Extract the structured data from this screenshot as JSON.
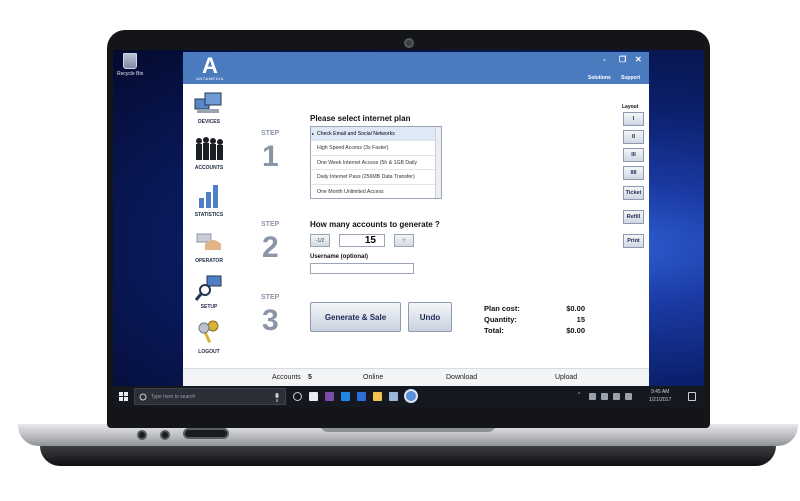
{
  "desktop": {
    "recycle_label": "Recycle Bin"
  },
  "app": {
    "logo_letter": "A",
    "logo_text": "ANTAMEDIA",
    "window_controls": {
      "minimize": "-",
      "restore": "❐",
      "close": "✕"
    },
    "top_links": [
      "Solutions",
      "Support"
    ],
    "nav": [
      {
        "label": "DEVICES",
        "icon": "devices-icon"
      },
      {
        "label": "ACCOUNTS",
        "icon": "accounts-icon"
      },
      {
        "label": "STATISTICS",
        "icon": "statistics-icon"
      },
      {
        "label": "OPERATOR",
        "icon": "operator-icon"
      },
      {
        "label": "SETUP",
        "icon": "setup-icon"
      },
      {
        "label": "LOGOUT",
        "icon": "logout-icon"
      }
    ],
    "steps": [
      {
        "label": "STEP",
        "number": "1"
      },
      {
        "label": "STEP",
        "number": "2"
      },
      {
        "label": "STEP",
        "number": "3"
      }
    ],
    "step1": {
      "heading": "Please select internet plan",
      "plans": [
        "Check Email and Social Networks",
        "High Speed Access (3x Faster)",
        "One Week Internet Access (5h & 1GB Daily",
        "Daily Internet Pass (256MB Data Transfer)",
        "One Month Unlimited Access"
      ],
      "selected_index": 0
    },
    "step2": {
      "heading": "How many accounts to generate ?",
      "minus_label": "-1/2",
      "quantity": "15",
      "plus_label": "+",
      "username_label": "Username (optional)",
      "username_value": ""
    },
    "step3": {
      "generate_label": "Generate & Sale",
      "undo_label": "Undo",
      "plan_cost_label": "Plan cost:",
      "plan_cost_value": "$0.00",
      "quantity_label": "Quantity:",
      "quantity_value": "15",
      "total_label": "Total:",
      "total_value": "$0.00"
    },
    "right_panel": {
      "layout_label": "Layout",
      "layout_buttons": [
        "I",
        "II",
        "III",
        "IIII"
      ],
      "ticket_label": "Ticket",
      "refill_label": "Refill",
      "print_label": "Print"
    },
    "status": {
      "accounts_label": "Accounts",
      "accounts_value": "5",
      "online_label": "Online",
      "download_label": "Download",
      "upload_label": "Upload"
    }
  },
  "taskbar": {
    "search_placeholder": "Type here to search",
    "time": "9:45 AM",
    "date": "1/21/2017"
  },
  "colors": {
    "titlebar": "#4a7bbf",
    "desktop": "#0b1f6b",
    "taskbar": "#15181f"
  }
}
